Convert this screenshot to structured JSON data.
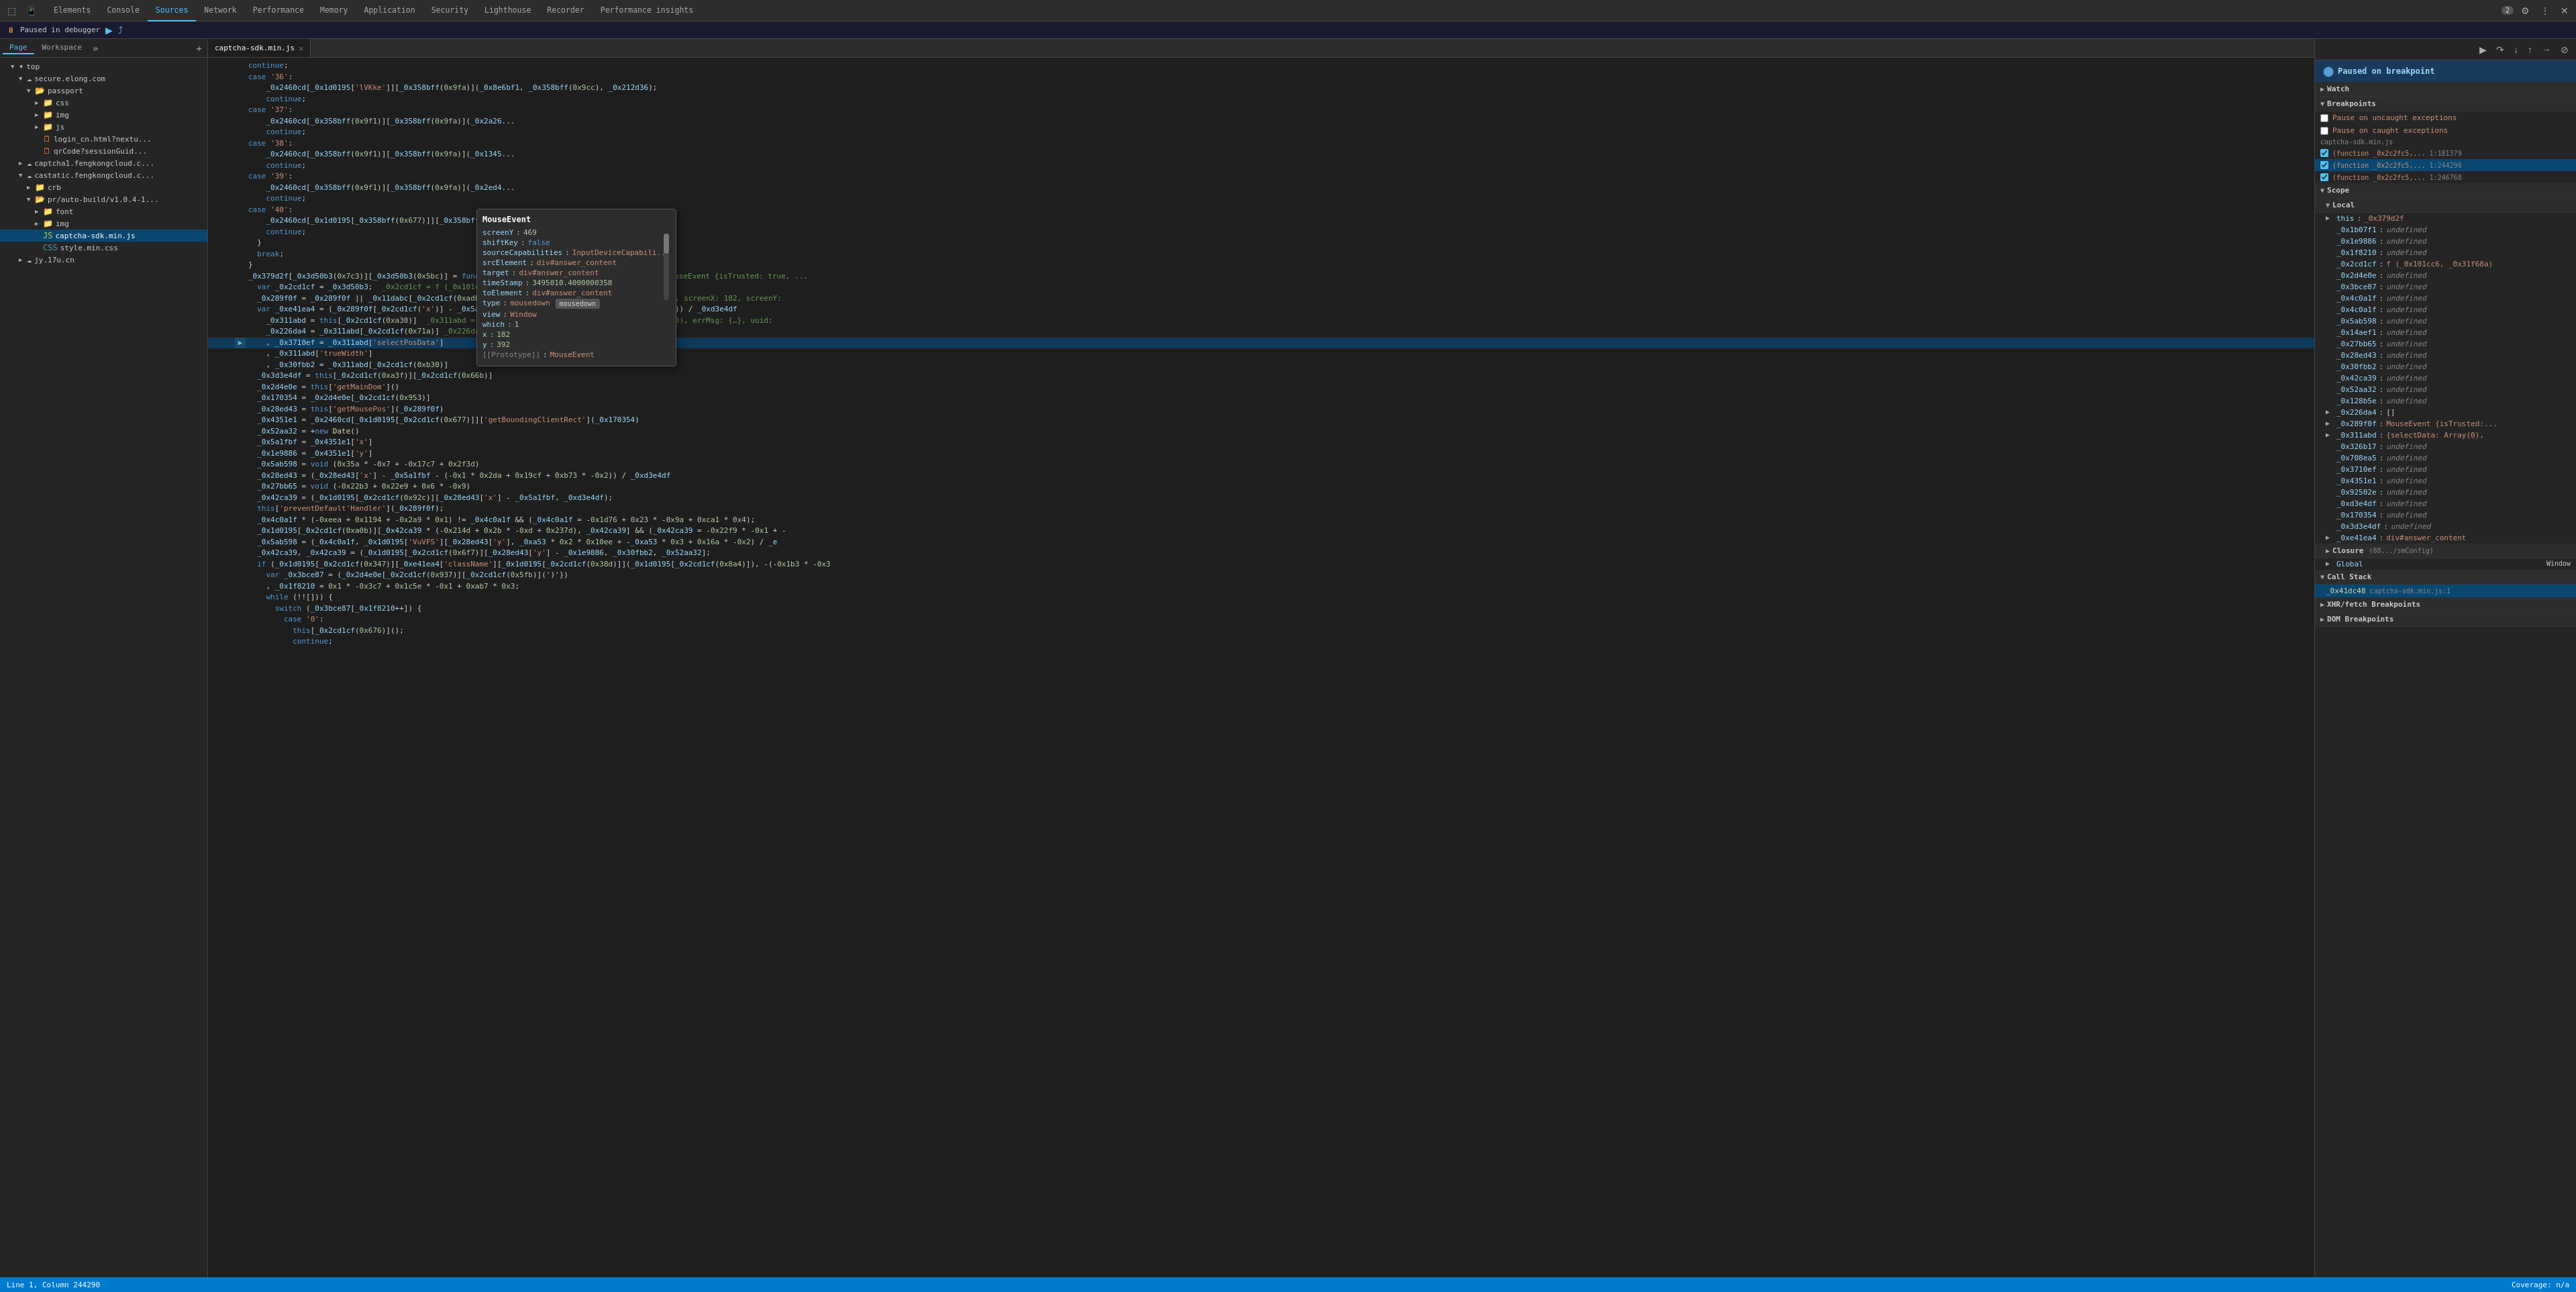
{
  "toolbar": {
    "tabs": [
      {
        "label": "Elements",
        "active": false
      },
      {
        "label": "Console",
        "active": false
      },
      {
        "label": "Sources",
        "active": true
      },
      {
        "label": "Network",
        "active": false
      },
      {
        "label": "Performance",
        "active": false
      },
      {
        "label": "Memory",
        "active": false
      },
      {
        "label": "Application",
        "active": false
      },
      {
        "label": "Security",
        "active": false
      },
      {
        "label": "Lighthouse",
        "active": false
      },
      {
        "label": "Recorder",
        "active": false
      },
      {
        "label": "Performance insights",
        "active": false
      }
    ],
    "badge_count": "2",
    "settings_label": "⚙",
    "more_label": "⋮",
    "close_label": "✕",
    "undock_label": "⊡"
  },
  "paused_banner": {
    "text": "Paused in debugger",
    "play_icon": "▶",
    "step_icon": "⤴"
  },
  "sources_panel": {
    "page_tab": "Page",
    "workspace_tab": "Workspace",
    "more_icon": "»",
    "add_icon": "+",
    "tree": {
      "top_label": "top",
      "secure_elong_com": "secure.elong.com",
      "passport": "passport",
      "css": "css",
      "img": "img",
      "js": "js",
      "login_cn_html": "login_cn.html?nextu...",
      "qrCode_session_guide": "qrCode?sessionGuid...",
      "captcha1_fengkong": "captcha1.fengkongcloud.c...",
      "castatic_fengkong": "castatic.fengkongcloud.c...",
      "crb": "crb",
      "pr_auto_build": "pr/auto-build/v1.0.4-1...",
      "font": "font",
      "img2": "img",
      "captcha_sdk_min": "captcha-sdk.min.js",
      "style_min": "style.min.css",
      "jy_17u_cn": "jy.17u.cn"
    }
  },
  "editor": {
    "tab_filename": "captcha-sdk.min.js",
    "close_icon": "✕",
    "lines": [
      {
        "num": "",
        "code": "    continue;"
      },
      {
        "num": "",
        "code": "case '36':"
      },
      {
        "num": "",
        "code": "    _0x2460cd[_0x1d0195['lVKke']][_0x358bff(0x9fa)](_0x8e6bf1, _0x358bff(0x9cc), _0x212d36);"
      },
      {
        "num": "",
        "code": "    continue;"
      },
      {
        "num": "",
        "code": "case '37':"
      },
      {
        "num": "",
        "code": "    _0x2460cd[_0x358bff(0x9f1)][_0x358bff(0x9fa)](_0x2a26..."
      },
      {
        "num": "",
        "code": "    continue;"
      },
      {
        "num": "",
        "code": "case '38':"
      },
      {
        "num": "",
        "code": "    _0x2460cd[_0x358bff(0x9f1)][_0x358bff(0x9fa)](_0x1345d..."
      },
      {
        "num": "",
        "code": "    continue;"
      },
      {
        "num": "",
        "code": "case '39':"
      },
      {
        "num": "",
        "code": "    _0x2460cd[_0x358bff(0x9f1)][_0x358bff(0x9fa)](_0x2ed4..."
      },
      {
        "num": "",
        "code": "    continue;"
      },
      {
        "num": "",
        "code": "case '40':"
      },
      {
        "num": "",
        "code": "    _0x2460cd[_0x1d0195[_0x358bff(0x677)]][_0x358bff(0x9fa..."
      },
      {
        "num": "",
        "code": "    continue;"
      },
      {
        "num": "",
        "code": "  }"
      },
      {
        "num": "",
        "code": "  break;"
      },
      {
        "num": "",
        "code": "}"
      },
      {
        "num": "",
        "code": "_0x379d2f[_0x3d50b3(0x7c3)][_0x3d50b3(0x5bc)] = function _0x41dc48(_0x289f0f) { _0x289f0f = MouseEvent {isTrusted: true, ..."
      },
      {
        "num": "",
        "code": "  var _0x2cd1cf = _0x3d50b3; _0x2cd1cf = f (_0x101cc6, _0x31f68a)"
      },
      {
        "num": "",
        "code": "  _0x289f0f = _0x289f0f || _0x11dabc[_0x2cd1cf(0xadb)]; _0x289f0f = MouseEvent {isTrusted: true, screenX: 182, screenY:"
      },
      {
        "num": "",
        "code": "  var _0xe41ea4 = (_0x289f0f[_0x2cd1cf('x')] - _0x5a1fbf - (-0x1 * 0x2da + 0x19cf + 0xb73 * -0x2)) / _0xd3e4df"
      },
      {
        "num": "",
        "code": "    _0x311abd = this[_0x2cd1cf(0xa30)]  _0x311abd = {selectData: Array(0), selectPosData: Array(0), errMsg: {…}, uuid:"
      },
      {
        "num": "",
        "code": "    _0x226da4 = _0x311abd[_0x2cd1cf(0x71a)] _0x226da4 = []"
      },
      {
        "num": "highlighted",
        "code": "    , _0x3710ef = _0x311abd['selectPosData']"
      },
      {
        "num": "",
        "code": "    , _0x311abd['trueWidth']"
      },
      {
        "num": "",
        "code": "    , _0x30fbb2 = _0x311abd[_0x2cd1cf(0xb30)]"
      },
      {
        "num": "",
        "code": "  _0x3d3e4df = this[_0x2cd1cf(0xa3f)][_0x2cd1cf(0x66b)]"
      },
      {
        "num": "",
        "code": "  _0x2d4e0e = this['getMainDom']()"
      },
      {
        "num": "",
        "code": "  _0x170354 = _0x2d4e0e[_0x2cd1cf(0x953)]"
      },
      {
        "num": "",
        "code": "  _0x28ed43 = this['getMousePos'](_0x289f0f)"
      },
      {
        "num": "",
        "code": "  _0x4351e1 = _0x2460cd[_0x1d0195[_0x2cd1cf(0x677)]]['getBoundingClientRect'](_0x170354)"
      },
      {
        "num": "",
        "code": "  _0x52aa32 = +new Date()"
      },
      {
        "num": "",
        "code": "  _0x5a1fbf = _0x4351e1['x']"
      },
      {
        "num": "",
        "code": "  _0x1e9886 = _0x4351e1['y']"
      },
      {
        "num": "",
        "code": "  _0x5ab598 = void (0x35a * -0x7 + -0x17c7 + 0x2f3d)"
      },
      {
        "num": "",
        "code": "  _0x28ed43 = (_0x28ed43['x'] - _0x5a1fbf - (-0x1 * 0x2da + 0x19cf + 0xb73 * -0x2)) / _0xd3e4df"
      },
      {
        "num": "",
        "code": "  _0x27bb65 = void (-0x22b3 + 0x22e9 + 0x6 * -0x9)"
      },
      {
        "num": "",
        "code": "  _0x42ca39 = (_0x1d0195[_0x2cd1cf(0x92c)][_0x28ed43['x'] - _0x5a1fbf, _0xd3e4df);"
      },
      {
        "num": "",
        "code": "  this['preventDefault'Handler'](_0x289f0f);"
      },
      {
        "num": "",
        "code": "  _0x4c0a1f * (-0xeea + 0x1194 + -0x2a9 * 0x1) != _0x4c0a1f && (_0x4c0a1f = -0x1d76 + 0x23 * -0x9a + 0xca1 * 0x4);"
      },
      {
        "num": "",
        "code": "  _0x1d0195[_0x2cd1cf(0xa0b)][_0x42ca39 * (-0x214d + 0x2b * -0xd + 0x237d), _0x42ca39] && (_0x42ca39 = -0x22f9 * -0x1 + -"
      },
      {
        "num": "",
        "code": "  _0x5ab598 = (_0x4c0a1f, _0x1d0195['VuVFS'][_0x28ed43['y'], _0xa53 * 0x2 * 0x10ee + -0xa53 * 0x3 + 0x16a * -0x2) / _e"
      },
      {
        "num": "",
        "code": "  _0x42ca39, _0x42ca39 = (_0x1d0195[_0x2cd1cf(0x6f7)][_0x28ed43['y'] - _0x1e9886, _0x30fbb2, _0x52aa32];"
      },
      {
        "num": "",
        "code": "  if (_0x1d0195[_0x2cd1cf(0x347)][_0xe41ea4['className'][_0x1d0195[_0x2cd1cf(0x38d)](_0x1d0195[_0x2cd1cf(0x8a4)]), -(-0x1b3 * -0x3"
      },
      {
        "num": "",
        "code": "    var _0x3bce87 = (_0x2d4e0e[_0x2cd1cf(0x937)][_0x2cd1cf(0x5fb)](')'}"
      },
      {
        "num": "",
        "code": "    , _0x1f8210 = 0x1 * -0x3c7 + 0x1c5e * -0x1 + 0xab7 * 0x3;"
      },
      {
        "num": "",
        "code": "    while (!![])) {"
      },
      {
        "num": "",
        "code": "      switch (_0x3bce87[_0x1f8210++]) {"
      },
      {
        "num": "",
        "code": "        case '0':"
      },
      {
        "num": "",
        "code": "          this[_0x2cd1cf(0x676)]();"
      },
      {
        "num": "",
        "code": "          continue;"
      }
    ]
  },
  "tooltip": {
    "title": "MouseEvent",
    "screenY_key": "screenY",
    "screenY_val": "469",
    "shiftKey_key": "shiftKey",
    "shiftKey_val": "false",
    "sourceCapabilities_key": "sourceCapabilities",
    "sourceCapabilities_val": "InputDeviceCapabili...",
    "srcElement_key": "srcElement",
    "srcElement_val": "div#answer_content",
    "target_key": "target",
    "target_val": "div#answer_content",
    "timeStamp_key": "timeStamp",
    "timeStamp_val": "3495010.4000000358",
    "toElement_key": "toElement",
    "toElement_val": "div#answer_content",
    "type_key": "type",
    "type_val": "mousedown",
    "view_key": "view",
    "view_val": "Window",
    "which_key": "which",
    "which_val": "1",
    "x_key": "x",
    "x_val": "182",
    "y_key": "y",
    "y_val": "392",
    "prototype_key": "[[Prototype]]",
    "prototype_val": "MouseEvent",
    "mousedown_badge": "mousedown"
  },
  "right_panel": {
    "paused_title": "Paused on breakpoint",
    "watch_label": "Watch",
    "breakpoints_label": "Breakpoints",
    "pause_uncaught_label": "Pause on uncaught exceptions",
    "pause_caught_label": "Pause on caught exceptions",
    "scope_label": "Scope",
    "local_label": "Local",
    "closure_label": "Closure",
    "global_label": "Global",
    "callstack_label": "Call Stack",
    "xhrfetch_label": "XHR/fetch Breakpoints",
    "dom_label": "DOM Breakpoints",
    "breakpoints": [
      {
        "file": "captcha-sdk.min.js",
        "loc": "1:181379",
        "checked": true
      },
      {
        "file": "captcha-sdk.min.js",
        "loc": "1:244290",
        "checked": true
      },
      {
        "file": "captcha-sdk.min.js",
        "loc": "1:246768",
        "checked": true
      }
    ],
    "scope_vars": [
      {
        "key": "this",
        "val": "_0x379d2f",
        "arrow": false
      },
      {
        "key": "_0x1b07f1",
        "val": "undefined",
        "arrow": false
      },
      {
        "key": "_0x1e9886",
        "val": "undefined",
        "arrow": false
      },
      {
        "key": "_0x1f8210",
        "val": "undefined",
        "arrow": false
      },
      {
        "key": "_0x2cd1cf",
        "val": "f (_0x101cc6, _0x31f68a)",
        "arrow": false
      },
      {
        "key": "_0x2d4e0e",
        "val": "undefined",
        "arrow": false
      },
      {
        "key": "_0x3bce87",
        "val": "undefined",
        "arrow": false
      },
      {
        "key": "_0x4c0a1f",
        "val": "undefined",
        "arrow": false
      },
      {
        "key": "_0x4c0a1f",
        "val": "undefined",
        "arrow": false
      },
      {
        "key": "_0x5ab598",
        "val": "undefined",
        "arrow": false
      },
      {
        "key": "_0x14aef1",
        "val": "undefined",
        "arrow": false
      },
      {
        "key": "_0x27bb65",
        "val": "undefined",
        "arrow": false
      },
      {
        "key": "_0x28ed43",
        "val": "undefined",
        "arrow": false
      },
      {
        "key": "_0x30fbb2",
        "val": "undefined",
        "arrow": false
      },
      {
        "key": "_0x42ca39",
        "val": "undefined",
        "arrow": false
      },
      {
        "key": "_0x52aa32",
        "val": "undefined",
        "arrow": false
      },
      {
        "key": "_0x128b5e",
        "val": "undefined",
        "arrow": false
      },
      {
        "key": "_0x226da4",
        "val": "[]",
        "arrow": true
      },
      {
        "key": "_0x289f0f",
        "val": "MouseEvent {isTrusted:...",
        "arrow": true
      },
      {
        "key": "_0x311abd",
        "val": "{selectData: Array(0),",
        "arrow": true
      },
      {
        "key": "_0x326b17",
        "val": "undefined",
        "arrow": false
      },
      {
        "key": "_0x708ea5",
        "val": "undefined",
        "arrow": false
      },
      {
        "key": "_0x3710ef",
        "val": "undefined",
        "arrow": false
      },
      {
        "key": "_0x4351e1",
        "val": "undefined",
        "arrow": false
      },
      {
        "key": "_0x92502e",
        "val": "undefined",
        "arrow": false
      },
      {
        "key": "_0xd3e4df",
        "val": "undefined",
        "arrow": false
      },
      {
        "key": "_0x170354",
        "val": "undefined",
        "arrow": false
      },
      {
        "key": "_0x3d3e4df",
        "val": "undefined",
        "arrow": false
      },
      {
        "key": "_0xe41ea4",
        "val": "div#answer_content",
        "arrow": true
      }
    ],
    "closure_items": [
      {
        "label": "Closure (88.../smConfig)"
      }
    ],
    "global_val": "Window",
    "callstack": [
      {
        "fn": "_0x41dc48",
        "file": "captcha-sdk.min.js:1",
        "active": true
      }
    ]
  },
  "status_bar": {
    "line_col": "Line 1, Column 244290",
    "coverage": "Coverage: n/a"
  }
}
